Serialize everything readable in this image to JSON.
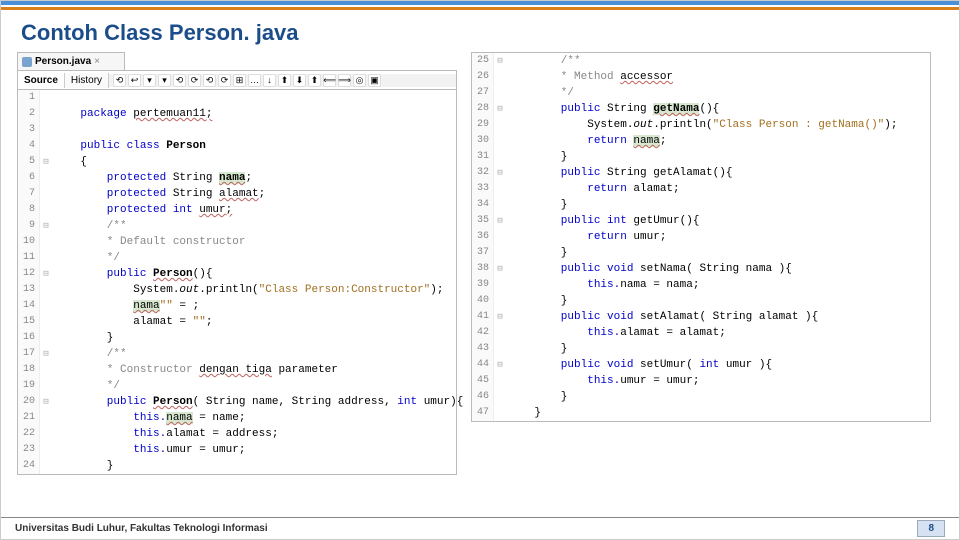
{
  "title": "Contoh Class Person. java",
  "fileTab": {
    "name": "Person.java"
  },
  "editorTabs": {
    "source": "Source",
    "history": "History"
  },
  "toolbarIcons": [
    "⟲",
    "↩",
    "▾",
    "▾",
    "⟲",
    "⟳",
    "⟲",
    "⟳",
    "⊞",
    "…",
    "↓",
    "⬆",
    "⬇",
    "⬆",
    "⟸",
    "⟹",
    "◎",
    "▣"
  ],
  "left": [
    {
      "n": "1",
      "t": ""
    },
    {
      "n": "2",
      "t": "    package ",
      "r": "pertemuan11;",
      "cls": "kw",
      "rcls": "wavy"
    },
    {
      "n": "3",
      "t": ""
    },
    {
      "n": "4",
      "t": "    public class ",
      "r": "Person",
      "cls": "kw",
      "rstyle": "bold"
    },
    {
      "n": "5",
      "f": "⊟",
      "t": "    {"
    },
    {
      "n": "6",
      "t": "        protected ",
      "r": "String ",
      "r2": "nama",
      ";": ";",
      "cls": "kw",
      "r2cls": "hl wavy",
      "r2b": true
    },
    {
      "n": "7",
      "t": "        protected ",
      "r": "String ",
      "r2": "alamat",
      ";": ";",
      "cls": "kw",
      "r2cls": "wavy"
    },
    {
      "n": "8",
      "t": "        protected int ",
      "r": "umur;",
      "cls": "kw",
      "rcls": "wavy"
    },
    {
      "n": "9",
      "f": "⊟",
      "t": "        /**",
      "cls": "cm"
    },
    {
      "n": "10",
      "t": "        * Default constructor",
      "cls": "cm"
    },
    {
      "n": "11",
      "t": "        */",
      "cls": "cm"
    },
    {
      "n": "12",
      "f": "⊟",
      "t": "        public ",
      "r": "Person",
      "r2": "(){",
      "cls": "kw",
      "rcls": "wavy",
      "rstyle": "bold"
    },
    {
      "n": "13",
      "t": "            System.",
      "r": "out",
      "r2": ".println(",
      "s": "\"Class Person:Constructor\"",
      "e": ");",
      "rstyle": "ital"
    },
    {
      "n": "14",
      "t": "            ",
      "r": "nama",
      "e": " = ",
      "s": "\"\"",
      "e2": ";",
      "rcls": "hl wavy"
    },
    {
      "n": "15",
      "t": "            alamat = ",
      "s": "\"\"",
      "e": ";"
    },
    {
      "n": "16",
      "t": "        }"
    },
    {
      "n": "17",
      "f": "⊟",
      "t": "        /**",
      "cls": "cm"
    },
    {
      "n": "18",
      "t": "        * Constructor ",
      "r": "dengan tiga",
      "e": " parameter",
      "cls": "cm",
      "rcls": "wavy"
    },
    {
      "n": "19",
      "t": "        */",
      "cls": "cm"
    },
    {
      "n": "20",
      "f": "⊟",
      "t": "        public ",
      "r": "Person",
      "r2": "( String name, String address, ",
      "r3": "int",
      "r4": " umur){",
      "cls": "kw",
      "rcls": "wavy",
      "rstyle": "bold",
      "r3cls": "kw"
    },
    {
      "n": "21",
      "t": "            this.",
      "r": "nama",
      "e": " = name;",
      "cls": "kw",
      "rcls": "hl wavy"
    },
    {
      "n": "22",
      "t": "            this.",
      "r": "alamat = address;",
      "cls": "kw"
    },
    {
      "n": "23",
      "t": "            this.",
      "r": "umur = umur;",
      "cls": "kw"
    },
    {
      "n": "24",
      "t": "        }"
    }
  ],
  "right": [
    {
      "n": "25",
      "f": "⊟",
      "t": "        /**",
      "cls": "cm"
    },
    {
      "n": "26",
      "t": "        * Method ",
      "r": "accessor",
      "cls": "cm",
      "rcls": "wavy"
    },
    {
      "n": "27",
      "t": "        */",
      "cls": "cm"
    },
    {
      "n": "28",
      "f": "⊟",
      "gut": "◎",
      "t": "        public ",
      "r": "String ",
      "r2": "getNama",
      "r3": "(){",
      "cls": "kw",
      "r2cls": "hl wavy",
      "r2b": true
    },
    {
      "n": "29",
      "t": "            System.",
      "r": "out",
      "r2": ".println(",
      "s": "\"Class Person : getNama()\"",
      "e": ");",
      "rstyle": "ital"
    },
    {
      "n": "30",
      "t": "            return ",
      "r": "nama",
      ";": ";",
      "cls": "kw",
      "rcls": "hl wavy"
    },
    {
      "n": "31",
      "t": "        }"
    },
    {
      "n": "32",
      "f": "⊟",
      "t": "        public ",
      "r": "String getAlamat(){",
      "cls": "kw"
    },
    {
      "n": "33",
      "t": "            return ",
      "r": "alamat;",
      "cls": "kw"
    },
    {
      "n": "34",
      "t": "        }"
    },
    {
      "n": "35",
      "f": "⊟",
      "t": "        public int ",
      "r": "getUmur(){",
      "cls": "kw"
    },
    {
      "n": "36",
      "t": "            return ",
      "r": "umur;",
      "cls": "kw"
    },
    {
      "n": "37",
      "t": "        }"
    },
    {
      "n": "38",
      "f": "⊟",
      "t": "        public void ",
      "r": "setNama( String nama ){",
      "cls": "kw"
    },
    {
      "n": "39",
      "t": "            this.",
      "r": "nama = nama;",
      "cls": "kw"
    },
    {
      "n": "40",
      "t": "        }"
    },
    {
      "n": "41",
      "f": "⊟",
      "t": "        public void ",
      "r": "setAlamat( String alamat ){",
      "cls": "kw"
    },
    {
      "n": "42",
      "t": "            this.",
      "r": "alamat = alamat;",
      "cls": "kw"
    },
    {
      "n": "43",
      "t": "        }"
    },
    {
      "n": "44",
      "f": "⊟",
      "t": "        public void ",
      "r": "setUmur( ",
      "r3": "int",
      "r4": " umur ){",
      "cls": "kw",
      "r3cls": "kw"
    },
    {
      "n": "45",
      "t": "            this.",
      "r": "umur = umur;",
      "cls": "kw"
    },
    {
      "n": "46",
      "t": "        }"
    },
    {
      "n": "47",
      "t": "    }"
    }
  ],
  "footer": {
    "university": "Universitas Budi Luhur, Fakultas Teknologi Informasi",
    "page": "8"
  }
}
